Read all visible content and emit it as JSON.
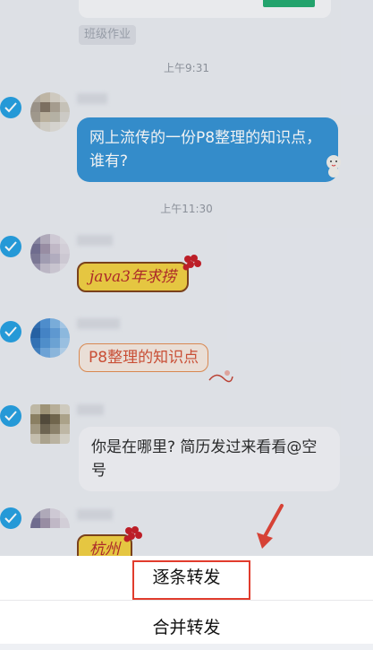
{
  "chat": {
    "tag_label": "班级作业",
    "times": [
      "上午9:31",
      "上午11:30"
    ],
    "messages": [
      {
        "text": "网上流传的一份P8整理的知识点，谁有?"
      },
      {
        "text": "java3年求捞"
      },
      {
        "text": "P8整理的知识点"
      },
      {
        "text": "你是在哪里? 简历发过来看看@空号"
      },
      {
        "text": "杭州"
      }
    ]
  },
  "sheet": {
    "items": [
      "逐条转发",
      "合并转发"
    ]
  },
  "colors": {
    "accent": "#1c9ce0",
    "highlight": "#e13c2d",
    "bubble_blue": "#2d8ed2"
  }
}
